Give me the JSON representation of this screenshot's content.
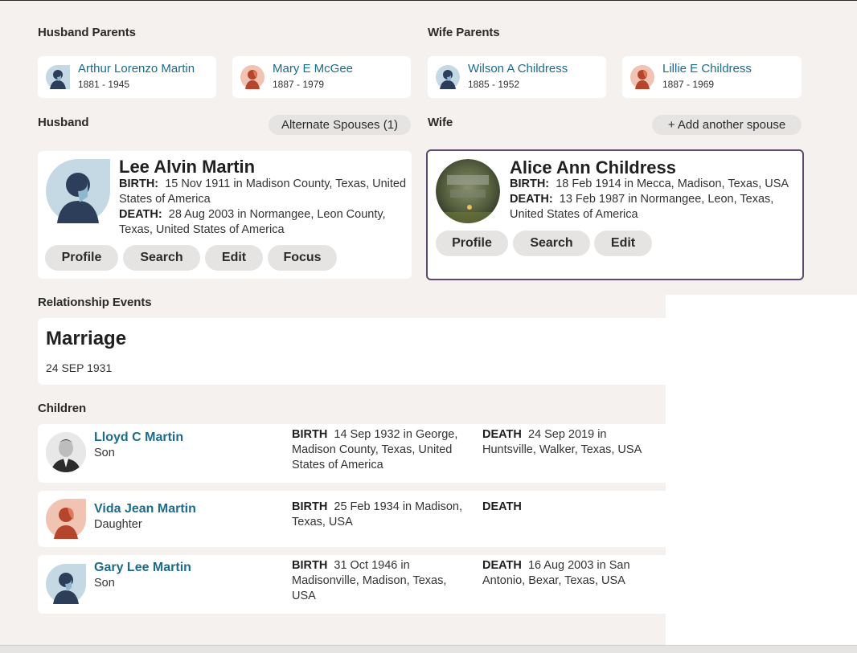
{
  "husband_parents": {
    "label": "Husband Parents",
    "father": {
      "name": "Arthur Lorenzo Martin",
      "dates": "1881 - 1945",
      "avatar_icon": "male-avatar-icon"
    },
    "mother": {
      "name": "Mary E McGee",
      "dates": "1887 - 1979",
      "avatar_icon": "female-avatar-icon"
    }
  },
  "wife_parents": {
    "label": "Wife Parents",
    "father": {
      "name": "Wilson A Childress",
      "dates": "1885 - 1952",
      "avatar_icon": "male-avatar-icon"
    },
    "mother": {
      "name": "Lillie E Childress",
      "dates": "1887 - 1969",
      "avatar_icon": "female-avatar-icon"
    }
  },
  "husband": {
    "label": "Husband",
    "alternate_spouses_label": "Alternate Spouses (1)",
    "name": "Lee Alvin Martin",
    "birth_label": "BIRTH:",
    "birth": "15 Nov 1911 in Madison County, Texas, United States of America",
    "death_label": "DEATH:",
    "death": "28 Aug 2003 in Normangee, Leon County, Texas, United States of America",
    "buttons": {
      "profile": "Profile",
      "search": "Search",
      "edit": "Edit",
      "focus": "Focus"
    }
  },
  "wife": {
    "label": "Wife",
    "add_spouse_label": "+ Add another spouse",
    "name": "Alice Ann Childress",
    "birth_label": "BIRTH:",
    "birth": "18 Feb 1914 in Mecca, Madison, Texas, USA",
    "death_label": "DEATH:",
    "death": "13 Feb 1987 in Normangee, Leon, Texas, United States of America",
    "buttons": {
      "profile": "Profile",
      "search": "Search",
      "edit": "Edit"
    }
  },
  "relationship_events": {
    "label": "Relationship Events",
    "event_title": "Marriage",
    "event_date": "24 SEP 1931"
  },
  "children": {
    "label": "Children",
    "items": [
      {
        "name": "Lloyd C Martin",
        "relation": "Son",
        "birth_label": "BIRTH",
        "birth": "14 Sep 1932  in George, Madison County, Texas, United States of America",
        "death_label": "DEATH",
        "death": "24 Sep 2019  in Huntsville, Walker, Texas, USA"
      },
      {
        "name": "Vida Jean Martin",
        "relation": "Daughter",
        "birth_label": "BIRTH",
        "birth": "25 Feb 1934  in Madison, Texas, USA",
        "death_label": "DEATH",
        "death": ""
      },
      {
        "name": "Gary Lee Martin",
        "relation": "Son",
        "birth_label": "BIRTH",
        "birth": "31 Oct 1946  in Madisonville, Madison, Texas, USA",
        "death_label": "DEATH",
        "death": "16 Aug 2003  in San Antonio, Bexar, Texas, USA"
      }
    ]
  },
  "colors": {
    "link": "#1c6b8c",
    "selected_border": "#5b4a6e",
    "pill_bg": "#e6e4e2",
    "page_bg": "#f4f1ee"
  }
}
